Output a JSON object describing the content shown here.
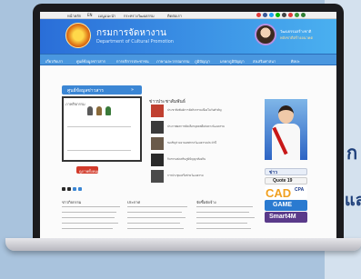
{
  "browser": {
    "links": [
      "หน้าหลัก",
      "EN",
      "เมนูแนะนำ",
      "กระทรวงวัฒนธรรม",
      "ติดต่อเรา"
    ]
  },
  "site": {
    "title_th": "กรมการจัดหางาน",
    "title_en": "Department of Cultural Promotion",
    "minister_text": "วัฒนธรรมสร้างชาติ",
    "minister_subtext": "พลังชาติสร้างอนาคต"
  },
  "nav": {
    "items": [
      "เกี่ยวกับเรา",
      "ศูนย์ข้อมูลข่าวสาร",
      "การบริการประชาชน",
      "ภาษาและวรรณกรรม",
      "ภูมิปัญญา",
      "มรดกภูมิปัญญา",
      "ส่งเสริมศาสนา",
      "ศิลปะ"
    ]
  },
  "gallery": {
    "tab_label": "ศูนย์ข้อมูลข่าวสาร",
    "tab_arrow": "»",
    "caption": "ภาพกิจกรรม",
    "button_label": "ดูภาพทั้งหมด"
  },
  "news": {
    "heading": "ข่าวประชาสัมพันธ์",
    "items": [
      "ประชาสัมพันธ์การจัดกิจกรรมเนื่องในวันสำคัญ",
      "ประกาศผลการคัดเลือกบุคคลดีเด่นทางวัฒนธรรม",
      "ขอเชิญร่วมงานเทศกาลวัฒนธรรมประจำปี",
      "กิจกรรมส่งเสริมภูมิปัญญาท้องถิ่น",
      "การประชุมเครือข่ายวัฒนธรรม"
    ]
  },
  "sidebar": {
    "promos": [
      "ข่าว",
      "Quote 19",
      "CAD",
      "CPA",
      "GAME",
      "Smart4M"
    ]
  },
  "footer_cols": [
    {
      "title": "ข่าวกิจกรรม"
    },
    {
      "title": "ประกาศ"
    },
    {
      "title": "จัดซื้อจัดจ้าง"
    }
  ],
  "outside": {
    "char_top": "ก",
    "char_bottom": "แล"
  },
  "colors": {
    "header_start": "#2a6ed8",
    "header_end": "#4ab0f0",
    "nav": "#4a97df",
    "accent_red": "#d23a2a"
  }
}
